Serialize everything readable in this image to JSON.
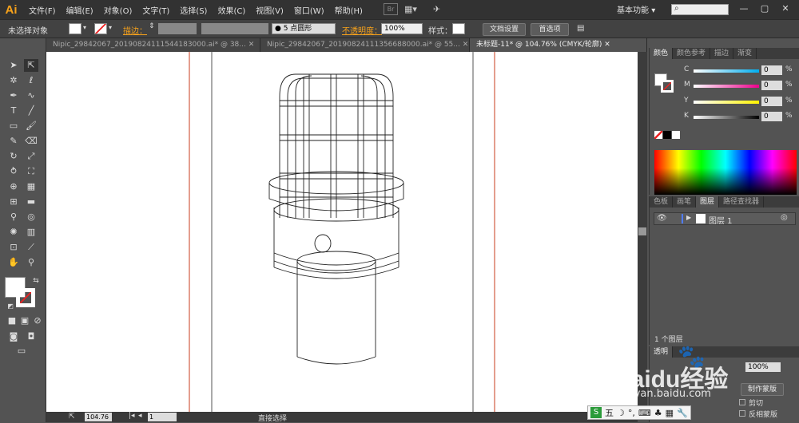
{
  "app": {
    "logo": "Ai"
  },
  "menu": [
    "文件(F)",
    "编辑(E)",
    "对象(O)",
    "文字(T)",
    "选择(S)",
    "效果(C)",
    "视图(V)",
    "窗口(W)",
    "帮助(H)"
  ],
  "menubar": {
    "br_label": "Br",
    "workspace": "基本功能",
    "window_controls": [
      "—",
      "▢",
      "✕"
    ]
  },
  "control": {
    "selection_label": "未选择对象",
    "stroke_label": "描边：",
    "brush_label": "5 点圆形",
    "opacity_label": "不透明度：",
    "opacity_value": "100%",
    "style_label": "样式：",
    "doc_setup": "文档设置",
    "preferences": "首选项"
  },
  "tabs": [
    {
      "label": "Nipic_29842067_20190824111544183000.ai* @ 38..."
    },
    {
      "label": "Nipic_29842067_20190824111356688000.ai* @ 55..."
    },
    {
      "label": "未标题-11* @ 104.76% (CMYK/轮廓)"
    }
  ],
  "status": {
    "zoom": "104.76",
    "page": "1",
    "tool": "直接选择"
  },
  "color_panel": {
    "tabs": [
      "颜色",
      "颜色参考",
      "描边",
      "渐变"
    ],
    "channels": [
      {
        "label": "C",
        "value": "0",
        "unit": "%",
        "color": "#00aeef"
      },
      {
        "label": "M",
        "value": "0",
        "unit": "%",
        "color": "#ec008c"
      },
      {
        "label": "Y",
        "value": "0",
        "unit": "%",
        "color": "#fff200"
      },
      {
        "label": "K",
        "value": "0",
        "unit": "%",
        "color": "#000000"
      }
    ]
  },
  "layers_panel": {
    "tabs": [
      "色板",
      "画笔",
      "图层",
      "路径查找器"
    ],
    "layer_name": "图层 1",
    "count": "1 个图层"
  },
  "bottom_panel": {
    "tab": "透明",
    "value": "100%",
    "make_mask": "制作蒙版",
    "clip": "剪切",
    "invert_mask": "反相蒙版"
  },
  "watermark": {
    "brand": "Baidu经验",
    "url": "jingyan.baidu.com"
  },
  "ime": {
    "label": "五"
  }
}
